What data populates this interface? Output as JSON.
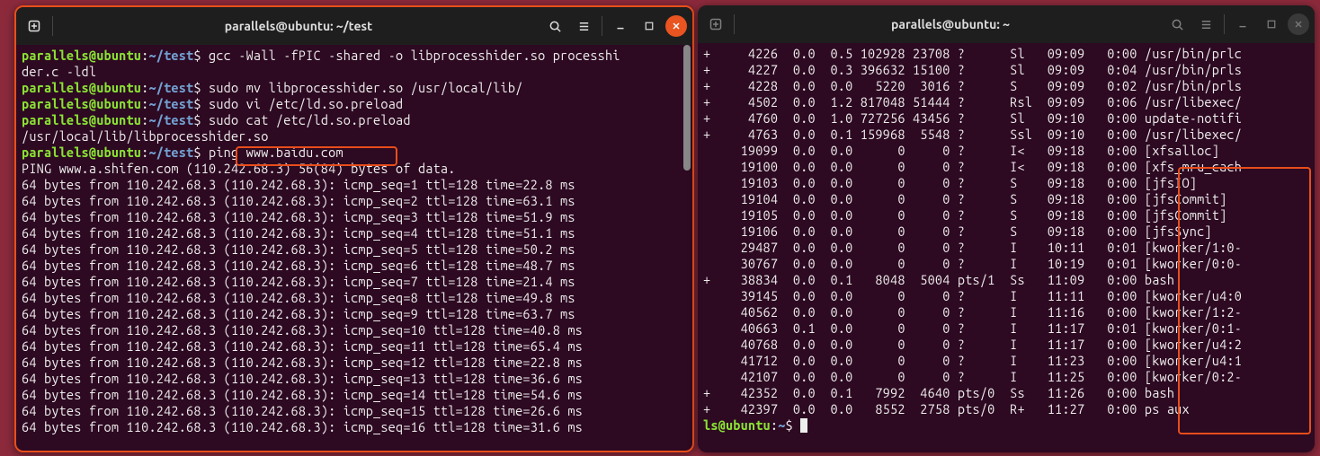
{
  "left": {
    "title": "parallels@ubuntu: ~/test",
    "prompt_user": "parallels@ubuntu",
    "prompt_path": "~/test",
    "cmd1": "gcc -Wall -fPIC -shared -o libprocesshider.so processhi",
    "cmd1b": "der.c -ldl",
    "cmd2": "sudo mv libprocesshider.so /usr/local/lib/",
    "cmd3": "sudo vi /etc/ld.so.preload",
    "cmd4": "sudo cat /etc/ld.so.preload",
    "catout": "/usr/local/lib/libprocesshider.so",
    "cmd5": "ping www.baidu.com",
    "ping_header": "PING www.a.shifen.com (110.242.68.3) 56(84) bytes of data.",
    "ping_lines": [
      "64 bytes from 110.242.68.3 (110.242.68.3): icmp_seq=1 ttl=128 time=22.8 ms",
      "64 bytes from 110.242.68.3 (110.242.68.3): icmp_seq=2 ttl=128 time=63.1 ms",
      "64 bytes from 110.242.68.3 (110.242.68.3): icmp_seq=3 ttl=128 time=51.9 ms",
      "64 bytes from 110.242.68.3 (110.242.68.3): icmp_seq=4 ttl=128 time=51.1 ms",
      "64 bytes from 110.242.68.3 (110.242.68.3): icmp_seq=5 ttl=128 time=50.2 ms",
      "64 bytes from 110.242.68.3 (110.242.68.3): icmp_seq=6 ttl=128 time=48.7 ms",
      "64 bytes from 110.242.68.3 (110.242.68.3): icmp_seq=7 ttl=128 time=21.4 ms",
      "64 bytes from 110.242.68.3 (110.242.68.3): icmp_seq=8 ttl=128 time=49.8 ms",
      "64 bytes from 110.242.68.3 (110.242.68.3): icmp_seq=9 ttl=128 time=63.7 ms",
      "64 bytes from 110.242.68.3 (110.242.68.3): icmp_seq=10 ttl=128 time=40.8 ms",
      "64 bytes from 110.242.68.3 (110.242.68.3): icmp_seq=11 ttl=128 time=65.4 ms",
      "64 bytes from 110.242.68.3 (110.242.68.3): icmp_seq=12 ttl=128 time=22.8 ms",
      "64 bytes from 110.242.68.3 (110.242.68.3): icmp_seq=13 ttl=128 time=36.6 ms",
      "64 bytes from 110.242.68.3 (110.242.68.3): icmp_seq=14 ttl=128 time=54.6 ms",
      "64 bytes from 110.242.68.3 (110.242.68.3): icmp_seq=15 ttl=128 time=26.6 ms",
      "64 bytes from 110.242.68.3 (110.242.68.3): icmp_seq=16 ttl=128 time=31.6 ms"
    ]
  },
  "right": {
    "title": "parallels@ubuntu: ~",
    "rows": [
      {
        "mark": "+",
        "pid": "4226",
        "cpu": "0.0",
        "mem": "0.5",
        "vsz": "102928",
        "rss": "23708",
        "tty": "?",
        "stat": "Sl",
        "start": "09:09",
        "time": "0:00",
        "cmd": "/usr/bin/prlc"
      },
      {
        "mark": "+",
        "pid": "4227",
        "cpu": "0.0",
        "mem": "0.3",
        "vsz": "396632",
        "rss": "15100",
        "tty": "?",
        "stat": "Sl",
        "start": "09:09",
        "time": "0:04",
        "cmd": "/usr/bin/prls"
      },
      {
        "mark": "+",
        "pid": "4228",
        "cpu": "0.0",
        "mem": "0.0",
        "vsz": "5220",
        "rss": "3016",
        "tty": "?",
        "stat": "S",
        "start": "09:09",
        "time": "0:02",
        "cmd": "/usr/bin/prls"
      },
      {
        "mark": "+",
        "pid": "4502",
        "cpu": "0.0",
        "mem": "1.2",
        "vsz": "817048",
        "rss": "51444",
        "tty": "?",
        "stat": "Rsl",
        "start": "09:09",
        "time": "0:06",
        "cmd": "/usr/libexec/"
      },
      {
        "mark": "+",
        "pid": "4760",
        "cpu": "0.0",
        "mem": "1.0",
        "vsz": "727256",
        "rss": "43456",
        "tty": "?",
        "stat": "Sl",
        "start": "09:10",
        "time": "0:00",
        "cmd": "update-notifi"
      },
      {
        "mark": "+",
        "pid": "4763",
        "cpu": "0.0",
        "mem": "0.1",
        "vsz": "159968",
        "rss": "5548",
        "tty": "?",
        "stat": "Ssl",
        "start": "09:10",
        "time": "0:00",
        "cmd": "/usr/libexec/"
      },
      {
        "mark": "",
        "pid": "19099",
        "cpu": "0.0",
        "mem": "0.0",
        "vsz": "0",
        "rss": "0",
        "tty": "?",
        "stat": "I<",
        "start": "09:18",
        "time": "0:00",
        "cmd": "[xfsalloc]"
      },
      {
        "mark": "",
        "pid": "19100",
        "cpu": "0.0",
        "mem": "0.0",
        "vsz": "0",
        "rss": "0",
        "tty": "?",
        "stat": "I<",
        "start": "09:18",
        "time": "0:00",
        "cmd": "[xfs_mru_cach"
      },
      {
        "mark": "",
        "pid": "19103",
        "cpu": "0.0",
        "mem": "0.0",
        "vsz": "0",
        "rss": "0",
        "tty": "?",
        "stat": "S",
        "start": "09:18",
        "time": "0:00",
        "cmd": "[jfsIO]"
      },
      {
        "mark": "",
        "pid": "19104",
        "cpu": "0.0",
        "mem": "0.0",
        "vsz": "0",
        "rss": "0",
        "tty": "?",
        "stat": "S",
        "start": "09:18",
        "time": "0:00",
        "cmd": "[jfsCommit]"
      },
      {
        "mark": "",
        "pid": "19105",
        "cpu": "0.0",
        "mem": "0.0",
        "vsz": "0",
        "rss": "0",
        "tty": "?",
        "stat": "S",
        "start": "09:18",
        "time": "0:00",
        "cmd": "[jfsCommit]"
      },
      {
        "mark": "",
        "pid": "19106",
        "cpu": "0.0",
        "mem": "0.0",
        "vsz": "0",
        "rss": "0",
        "tty": "?",
        "stat": "S",
        "start": "09:18",
        "time": "0:00",
        "cmd": "[jfsSync]"
      },
      {
        "mark": "",
        "pid": "29487",
        "cpu": "0.0",
        "mem": "0.0",
        "vsz": "0",
        "rss": "0",
        "tty": "?",
        "stat": "I",
        "start": "10:11",
        "time": "0:01",
        "cmd": "[kworker/1:0-"
      },
      {
        "mark": "",
        "pid": "30767",
        "cpu": "0.0",
        "mem": "0.0",
        "vsz": "0",
        "rss": "0",
        "tty": "?",
        "stat": "I",
        "start": "10:19",
        "time": "0:01",
        "cmd": "[kworker/0:0-"
      },
      {
        "mark": "+",
        "pid": "38834",
        "cpu": "0.0",
        "mem": "0.1",
        "vsz": "8048",
        "rss": "5004",
        "tty": "pts/1",
        "stat": "Ss",
        "start": "11:09",
        "time": "0:00",
        "cmd": "bash"
      },
      {
        "mark": "",
        "pid": "39145",
        "cpu": "0.0",
        "mem": "0.0",
        "vsz": "0",
        "rss": "0",
        "tty": "?",
        "stat": "I",
        "start": "11:11",
        "time": "0:00",
        "cmd": "[kworker/u4:0"
      },
      {
        "mark": "",
        "pid": "40562",
        "cpu": "0.0",
        "mem": "0.0",
        "vsz": "0",
        "rss": "0",
        "tty": "?",
        "stat": "I",
        "start": "11:16",
        "time": "0:00",
        "cmd": "[kworker/1:2-"
      },
      {
        "mark": "",
        "pid": "40663",
        "cpu": "0.1",
        "mem": "0.0",
        "vsz": "0",
        "rss": "0",
        "tty": "?",
        "stat": "I",
        "start": "11:17",
        "time": "0:01",
        "cmd": "[kworker/0:1-"
      },
      {
        "mark": "",
        "pid": "40768",
        "cpu": "0.0",
        "mem": "0.0",
        "vsz": "0",
        "rss": "0",
        "tty": "?",
        "stat": "I",
        "start": "11:17",
        "time": "0:00",
        "cmd": "[kworker/u4:2"
      },
      {
        "mark": "",
        "pid": "41712",
        "cpu": "0.0",
        "mem": "0.0",
        "vsz": "0",
        "rss": "0",
        "tty": "?",
        "stat": "I",
        "start": "11:23",
        "time": "0:00",
        "cmd": "[kworker/u4:1"
      },
      {
        "mark": "",
        "pid": "42107",
        "cpu": "0.0",
        "mem": "0.0",
        "vsz": "0",
        "rss": "0",
        "tty": "?",
        "stat": "I",
        "start": "11:25",
        "time": "0:00",
        "cmd": "[kworker/0:2-"
      },
      {
        "mark": "+",
        "pid": "42352",
        "cpu": "0.0",
        "mem": "0.1",
        "vsz": "7992",
        "rss": "4640",
        "tty": "pts/0",
        "stat": "Ss",
        "start": "11:26",
        "time": "0:00",
        "cmd": "bash"
      },
      {
        "mark": "+",
        "pid": "42397",
        "cpu": "0.0",
        "mem": "0.0",
        "vsz": "8552",
        "rss": "2758",
        "tty": "pts/0",
        "stat": "R+",
        "start": "11:27",
        "time": "0:00",
        "cmd": "ps aux"
      }
    ],
    "prompt_user": "ls@ubuntu",
    "prompt_path": "~",
    "prompt_cmd": ""
  }
}
